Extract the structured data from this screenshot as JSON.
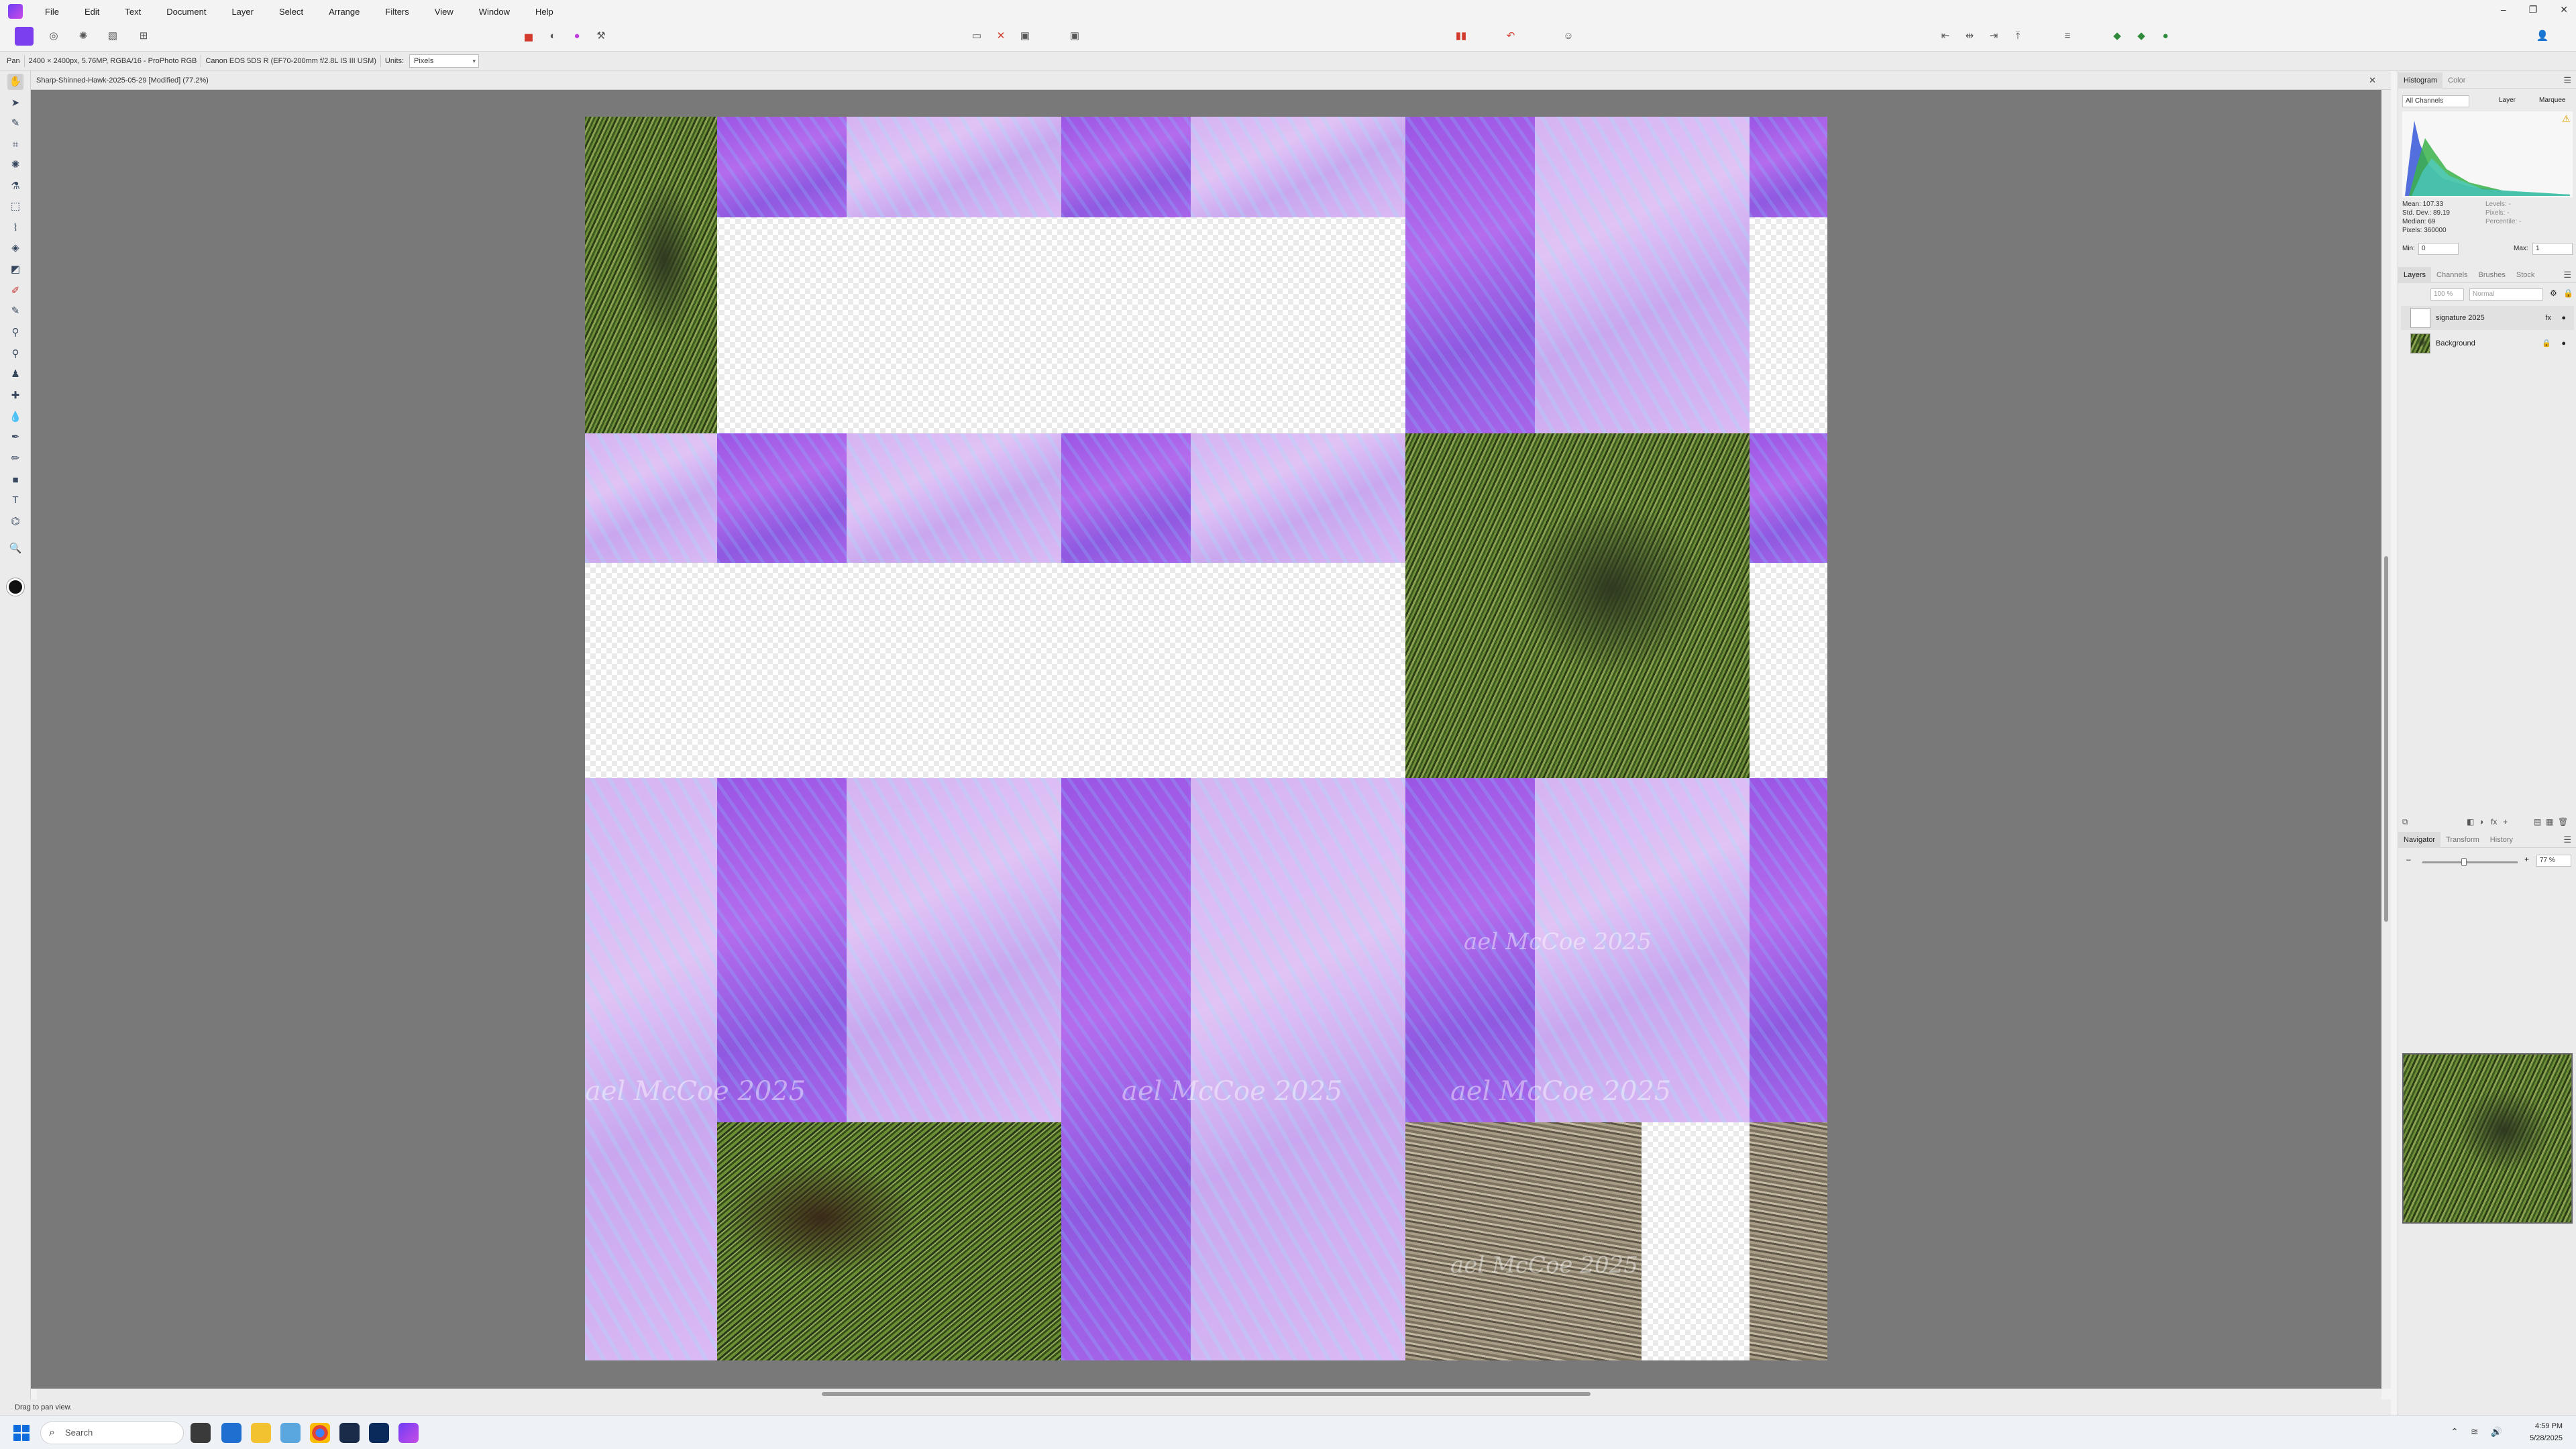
{
  "menu": {
    "items": [
      "File",
      "Edit",
      "Text",
      "Document",
      "Layer",
      "Select",
      "Arrange",
      "Filters",
      "View",
      "Window",
      "Help"
    ]
  },
  "window_controls": {
    "minimize": "–",
    "restore": "❐",
    "close": "✕"
  },
  "context_bar": {
    "tool": "Pan",
    "doc_info": "2400 × 2400px, 5.76MP, RGBA/16 - ProPhoto RGB",
    "camera_info": "Canon EOS 5DS R (EF70-200mm f/2.8L IS III USM)",
    "units_label": "Units:",
    "units_value": "Pixels"
  },
  "document": {
    "tab_title": "Sharp-Shinned-Hawk-2025-05-29 [Modified] (77.2%)",
    "watermark": "ael McCoe 2025"
  },
  "status": {
    "hint": "Drag to pan view."
  },
  "histogram_panel": {
    "tabs": [
      "Histogram",
      "Color"
    ],
    "channels": "All Channels",
    "layer_label": "Layer",
    "marquee_label": "Marquee",
    "stats": [
      "Mean: 107.33",
      "Std. Dev.: 89.19",
      "Median: 69",
      "Pixels: 360000"
    ],
    "stats_right": [
      "Levels: -",
      "Pixels: -",
      "Percentile: -"
    ],
    "min_label": "Min:",
    "min_value": "0",
    "max_label": "Max:",
    "max_value": "1"
  },
  "layers_panel": {
    "tabs": [
      "Layers",
      "Channels",
      "Brushes",
      "Stock"
    ],
    "opacity": "100 %",
    "blend": "Normal",
    "layers": [
      {
        "name": "signature 2025",
        "fx": "fx"
      },
      {
        "name": "Background"
      }
    ]
  },
  "navigator_panel": {
    "tabs": [
      "Navigator",
      "Transform",
      "History"
    ],
    "zoom": "77 %",
    "zoom_level": 0.43,
    "minus": "–",
    "plus": "+"
  },
  "taskbar": {
    "search_placeholder": "Search",
    "time": "4:59 PM",
    "date": "5/28/2025"
  },
  "icons": {
    "pan_tool": "hand-icon",
    "move_tool": "arrow-pointer-icon",
    "search": "magnifier-icon"
  }
}
